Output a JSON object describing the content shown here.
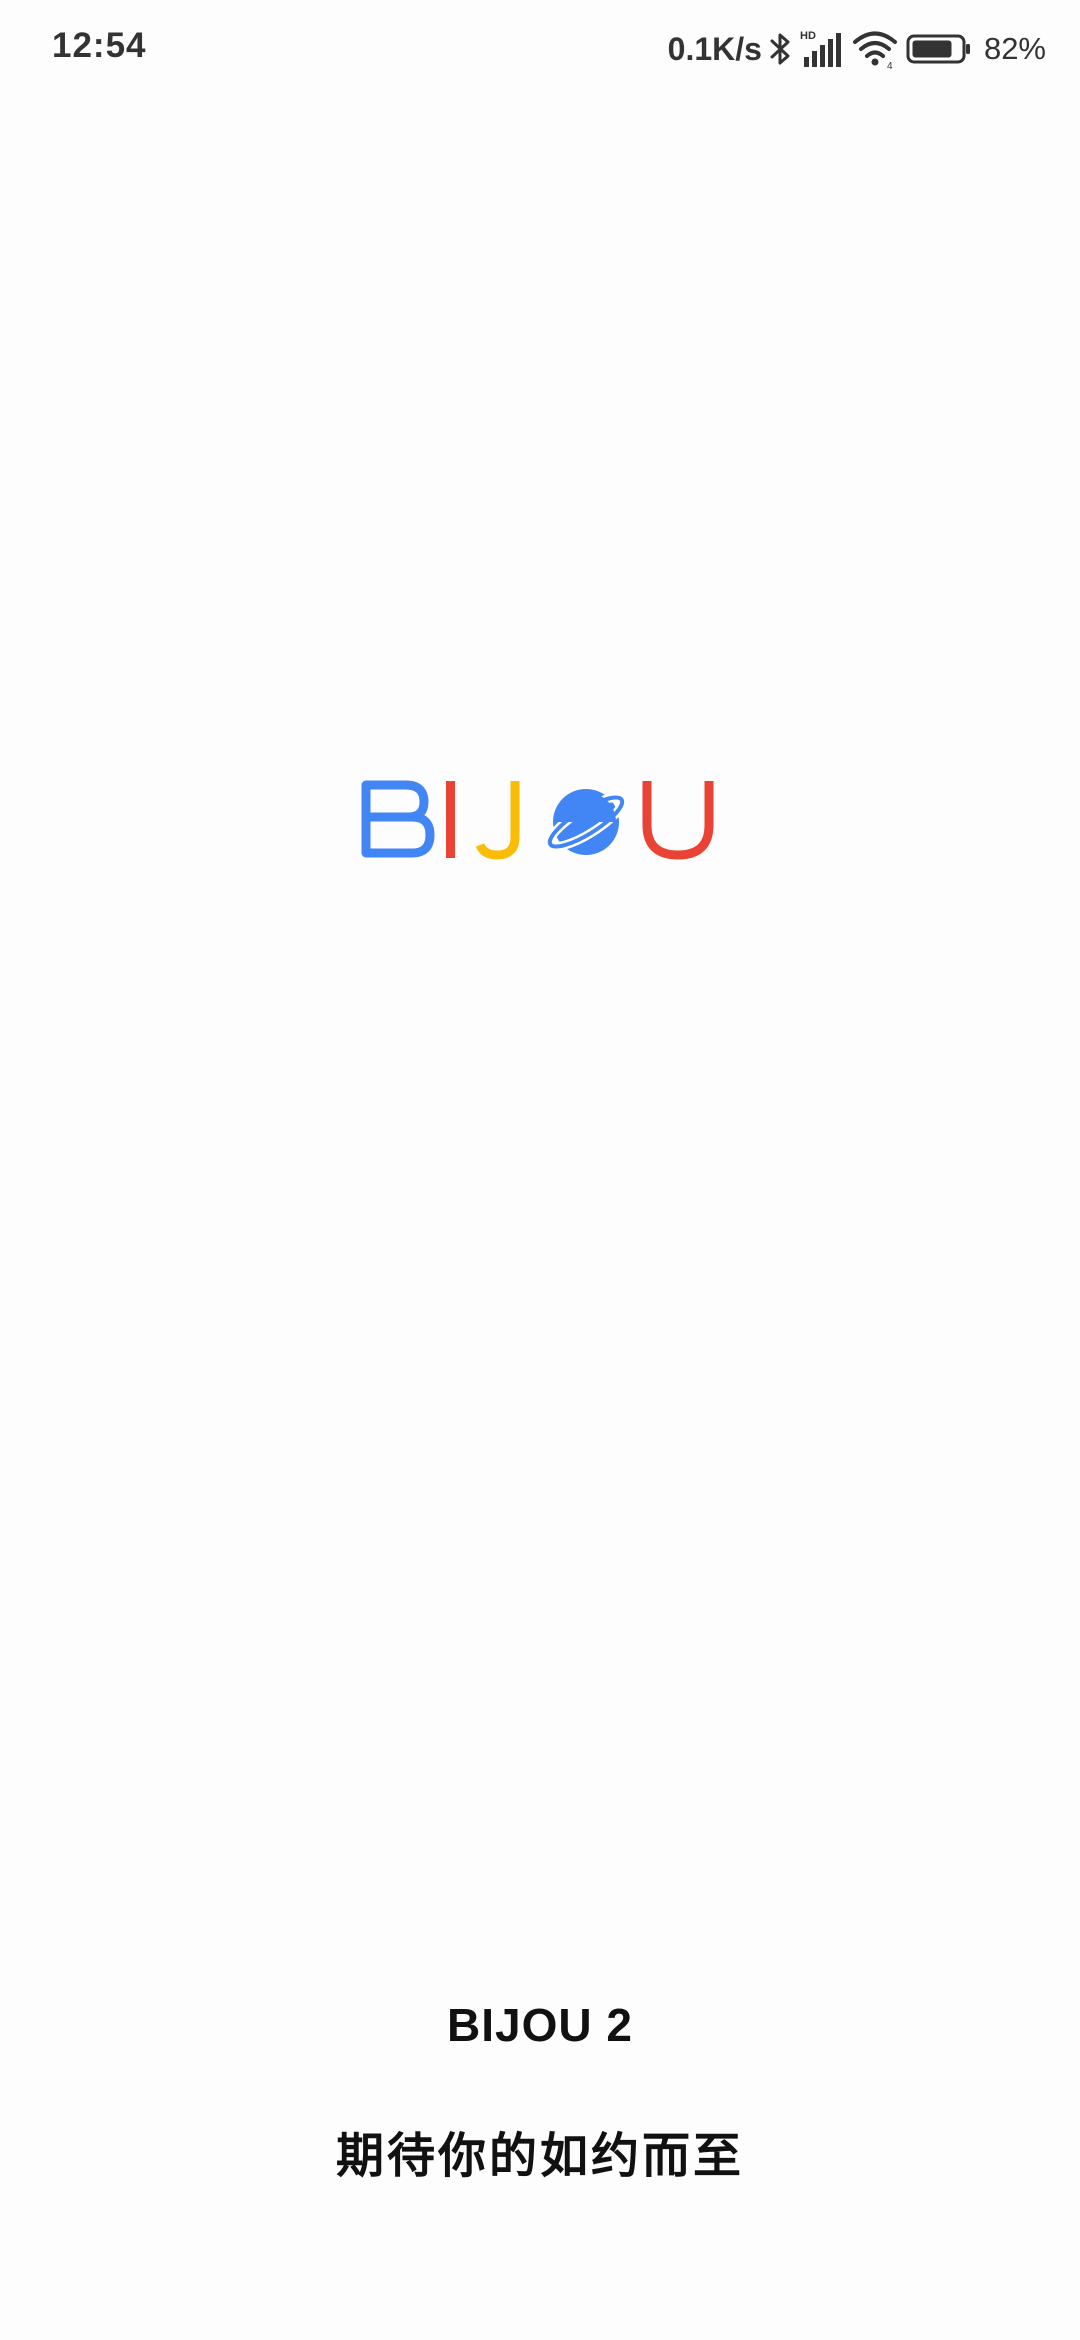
{
  "status_bar": {
    "time": "12:54",
    "net_speed": "0.1K/s",
    "battery_percent": "82%",
    "battery_level": 0.82,
    "icons": [
      "bluetooth-icon",
      "hd-signal-icon",
      "wifi-icon",
      "battery-icon"
    ]
  },
  "logo": {
    "letters": [
      "B",
      "I",
      "J",
      "O",
      "U"
    ],
    "colors": {
      "B": "#4285F4",
      "I": "#EA4335",
      "J": "#FBBC05",
      "O": "#4285F4",
      "U": "#EA4335"
    }
  },
  "footer": {
    "app_name": "BIJOU 2",
    "slogan": "期待你的如约而至"
  }
}
